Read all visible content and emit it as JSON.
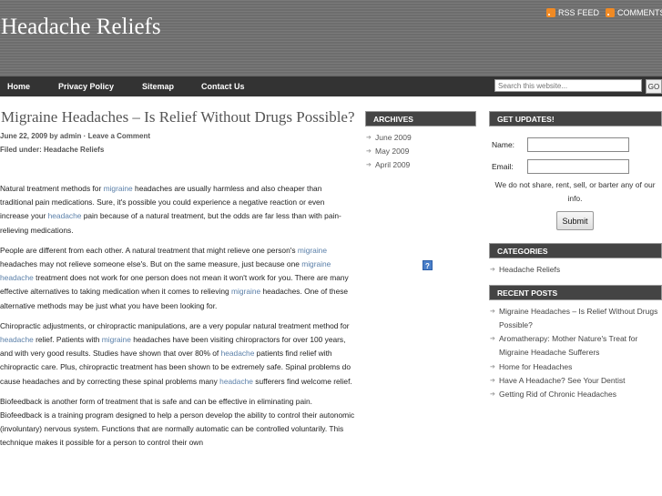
{
  "header": {
    "site_title": "Headache Reliefs",
    "rss_feed": "RSS FEED",
    "comments": "COMMENTS"
  },
  "nav": {
    "items": [
      "Home",
      "Privacy Policy",
      "Sitemap",
      "Contact Us"
    ]
  },
  "search": {
    "placeholder": "Search this website...",
    "button": "GO"
  },
  "post": {
    "title": "Migraine Headaches – Is Relief Without Drugs Possible?",
    "date": "June 22, 2009",
    "by": "by",
    "author": "admin",
    "sep": "·",
    "comment_link": "Leave a Comment",
    "filed_label": "Filed under:",
    "category": "Headache Reliefs",
    "p1": {
      "a": "Natural treatment methods for ",
      "l1": "migraine",
      "b": " headaches are usually harmless and also cheaper than traditional pain medications. Sure, it's possible you could experience a negative reaction or even increase your ",
      "l2": "headache",
      "c": " pain because of a natural treatment, but the odds are far less than with pain-relieving medications."
    },
    "p2": {
      "a": "People are different from each other. A natural treatment that might relieve one person's ",
      "l1": "migraine",
      "b": " headaches may not relieve someone else's. But on the same measure, just because one ",
      "l2": "migraine headache",
      "c": " treatment does not work for one person does not mean it won't work for you. There are many effective alternatives to taking medication when it comes to relieving ",
      "l3": "migraine",
      "d": " headaches. One of these alternative methods may be just what you have been looking for."
    },
    "p3": {
      "a": "Chiropractic adjustments, or chiropractic manipulations, are a very popular natural treatment method for ",
      "l1": "headache",
      "b": " relief. Patients with ",
      "l2": "migraine",
      "c": " headaches have been visiting chiropractors for over 100 years, and with very good results. Studies have shown that over 80% of ",
      "l3": "headache",
      "d": " patients find relief with chiropractic care. Plus, chiropractic treatment has been shown to be extremely safe. Spinal problems do cause headaches and by correcting these spinal problems many ",
      "l4": "headache",
      "e": " sufferers find welcome relief."
    },
    "p4": {
      "a": "Biofeedback is another form of treatment that is safe and can be effective in eliminating pain. Biofeedback is a training program designed to help a person develop the ability to control their autonomic (involuntary) nervous system. Functions that are normally automatic can be controlled voluntarily. This technique makes it possible for a person to control their own"
    }
  },
  "archives": {
    "title": "ARCHIVES",
    "items": [
      "June 2009",
      "May 2009",
      "April 2009"
    ]
  },
  "updates": {
    "title": "GET UPDATES!",
    "name_label": "Name:",
    "email_label": "Email:",
    "note": "We do not share, rent, sell, or barter any of our info.",
    "submit": "Submit"
  },
  "categories": {
    "title": "CATEGORIES",
    "items": [
      "Headache Reliefs"
    ]
  },
  "recent": {
    "title": "RECENT POSTS",
    "items": [
      "Migraine Headaches – Is Relief Without Drugs Possible?",
      "Aromatherapy: Mother Nature's Treat for Migraine Headache Sufferers",
      "Home for Headaches",
      "Have A Headache? See Your Dentist",
      "Getting Rid of Chronic Headaches"
    ]
  },
  "help_icon": "?"
}
